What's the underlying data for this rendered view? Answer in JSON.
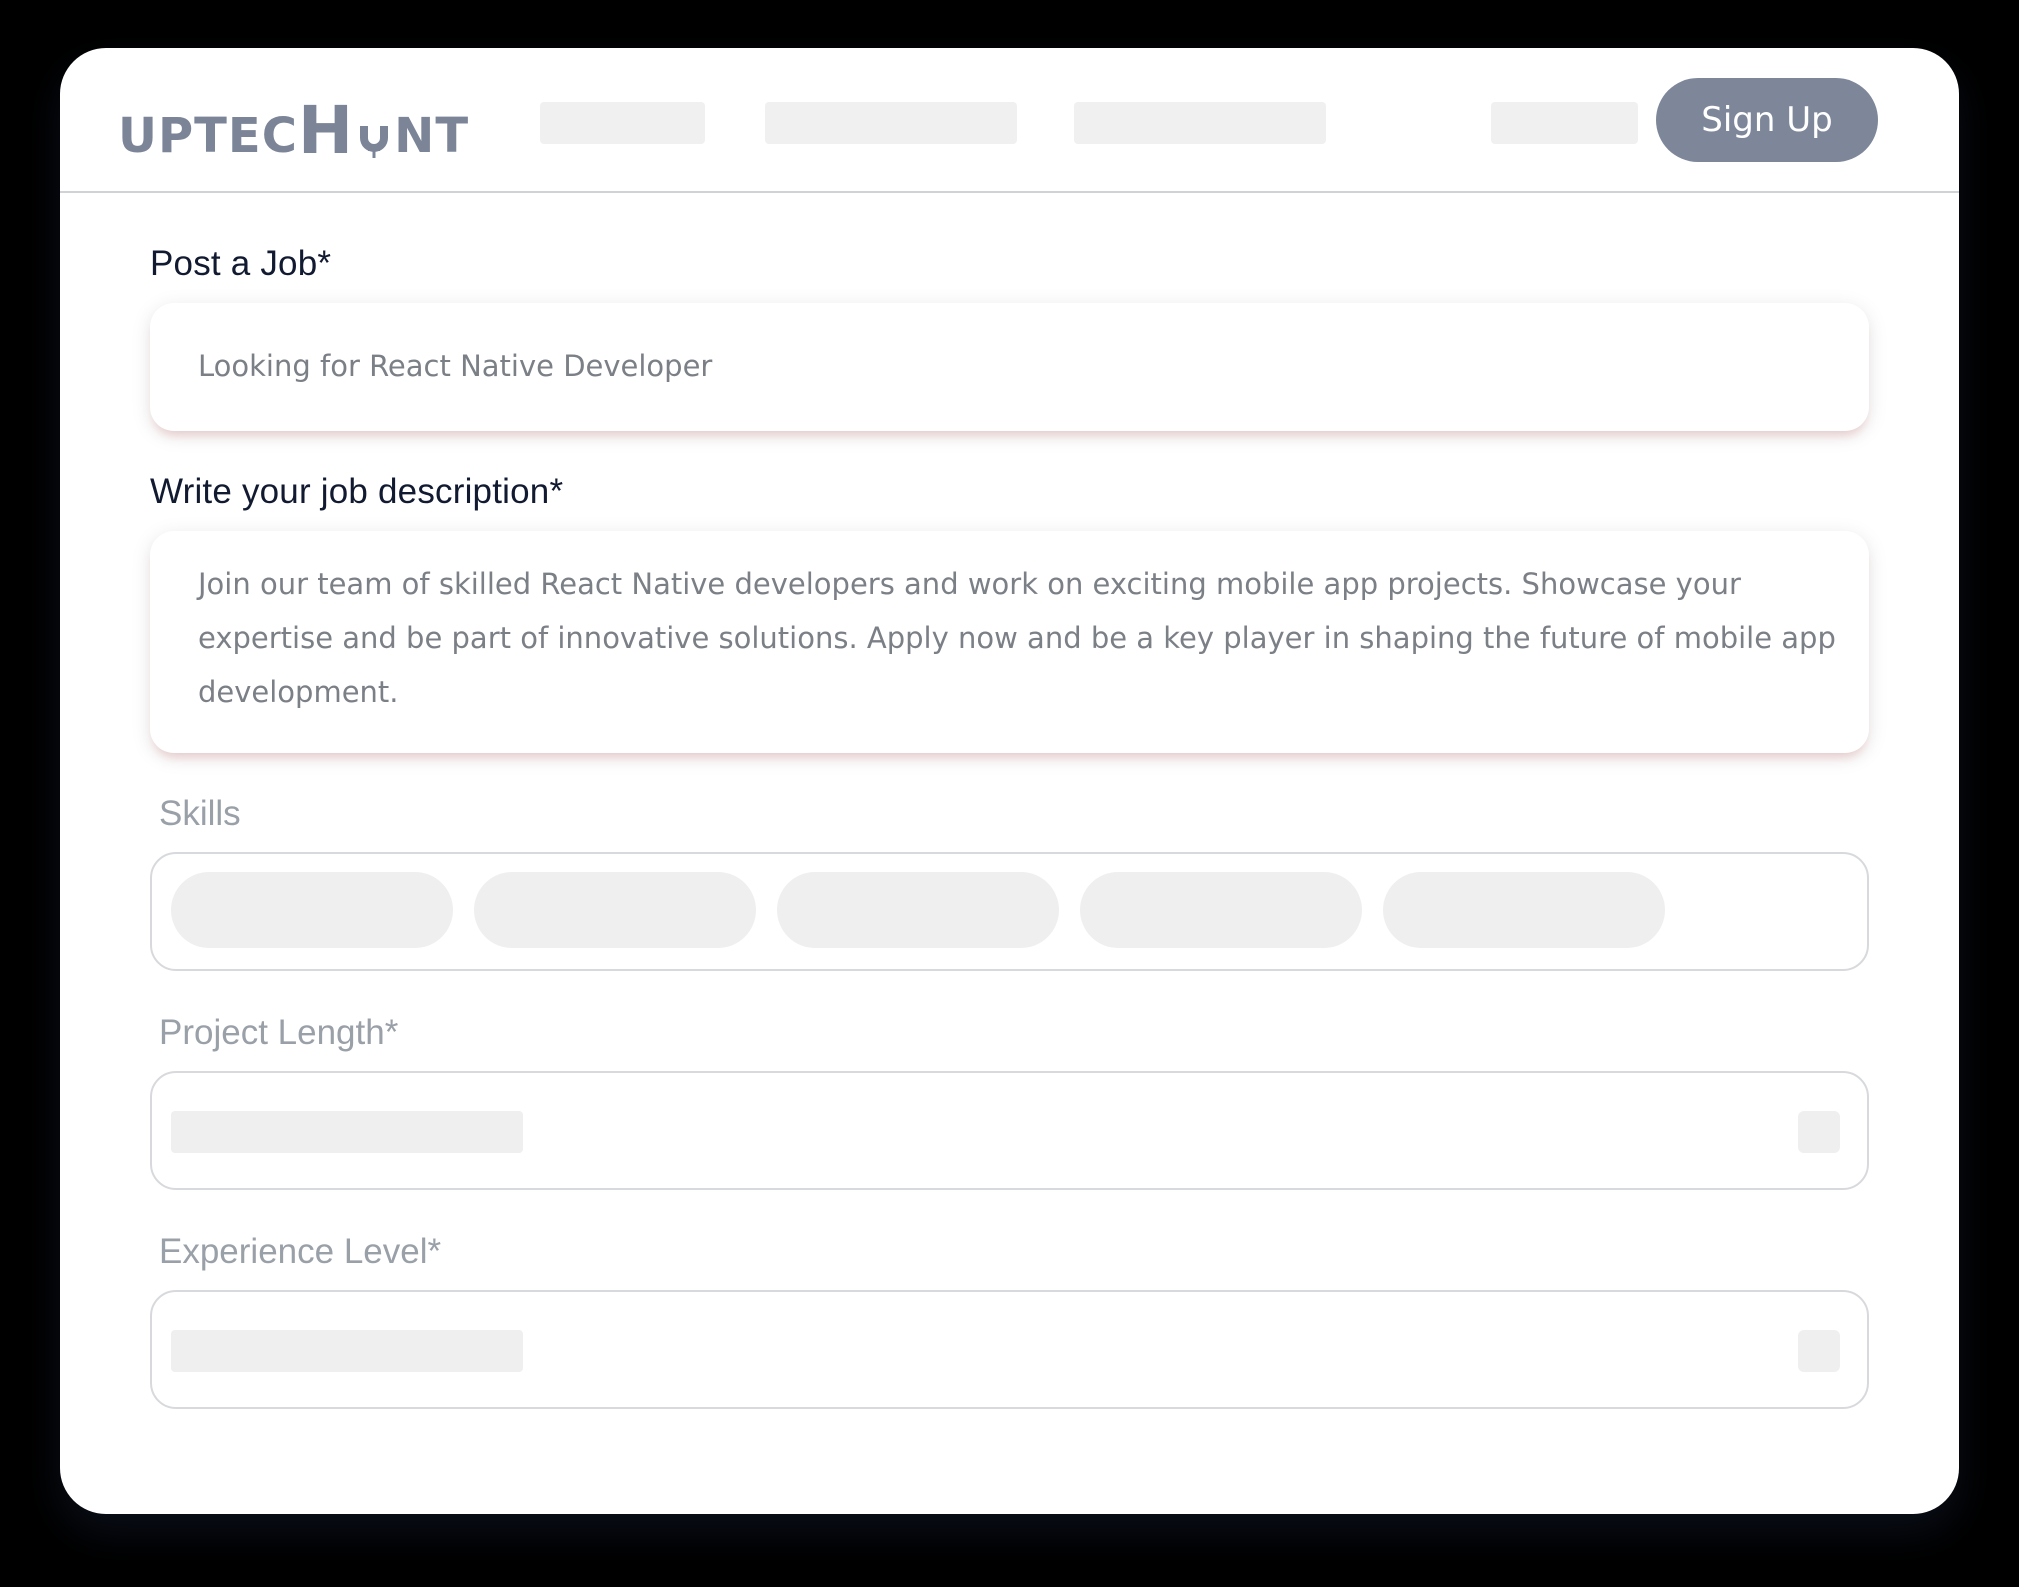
{
  "header": {
    "logo_prefix": "UPTEC",
    "logo_h": "H",
    "logo_suffix": "NT",
    "signup_label": "Sign Up"
  },
  "form": {
    "job_title_label": "Post a Job*",
    "job_title_value": "Looking for React Native Developer",
    "description_label": "Write your job description*",
    "description_value": "Join our team of skilled React Native developers and work on exciting mobile app projects. Showcase your expertise and be part of innovative solutions. Apply now and be a key player in shaping the future of mobile app development.",
    "skills_label": "Skills",
    "project_length_label": "Project Length*",
    "experience_level_label": "Experience Level*"
  },
  "icons": {
    "logo_mark": "magnet-icon",
    "dropdown": "chevron-down-icon"
  },
  "colors": {
    "signup_bg": "#7e8799",
    "label_dark": "#111a30",
    "label_muted": "#9aa0a8",
    "skeleton": "#efefef"
  }
}
